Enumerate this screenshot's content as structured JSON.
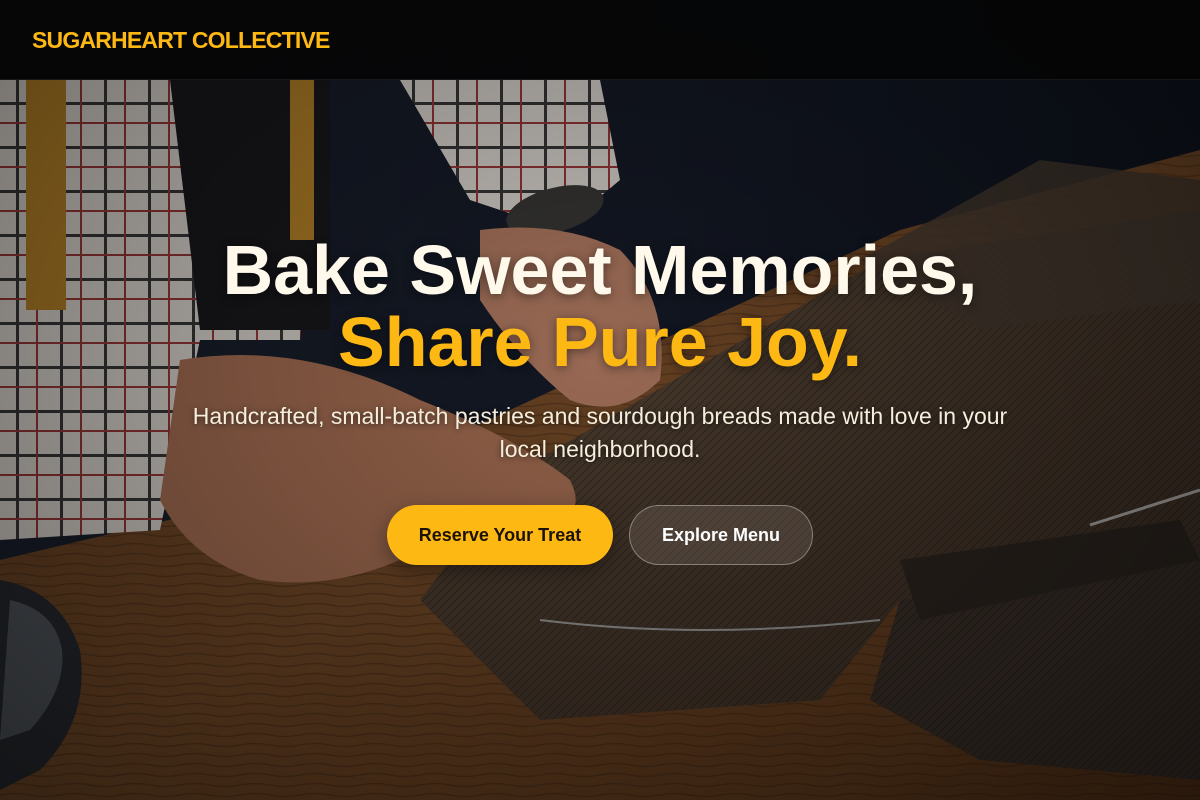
{
  "header": {
    "brand": "SUGARHEART COLLECTIVE"
  },
  "hero": {
    "headline_line1": "Bake Sweet Memories,",
    "headline_line2": "Share Pure Joy.",
    "subtitle": "Handcrafted, small-batch pastries and sourdough breads made with love in your local neighborhood.",
    "primary_button": "Reserve Your Treat",
    "secondary_button": "Explore Menu"
  },
  "colors": {
    "accent": "#FDB813",
    "headline": "#FFF9EC",
    "header_bg": "#050505"
  }
}
